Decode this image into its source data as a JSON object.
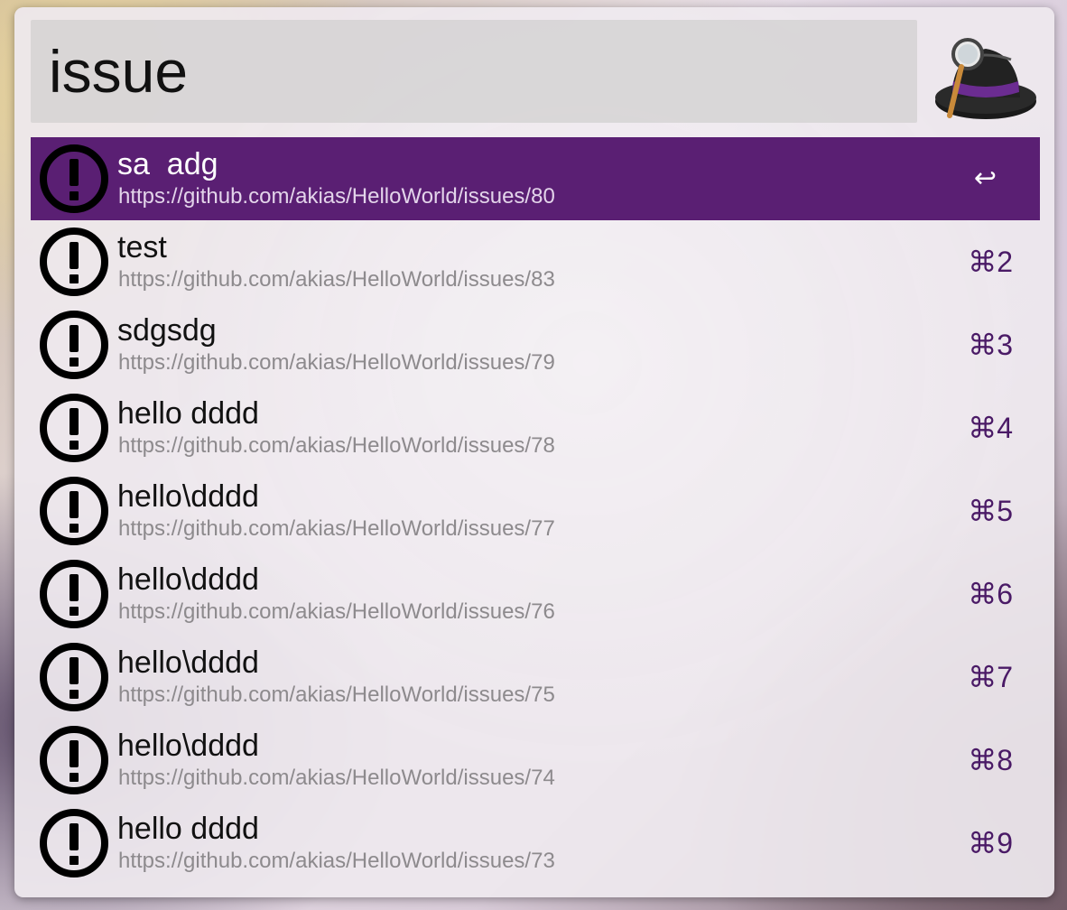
{
  "search": {
    "value": "issue"
  },
  "colors": {
    "selection": "#5a1f73",
    "shortcut": "#4a1a66",
    "subtitle": "#8d8a8d"
  },
  "results": [
    {
      "title": "sa  adg",
      "subtitle": "https://github.com/akias/HelloWorld/issues/80",
      "shortcut": "↩",
      "selected": true,
      "icon": "issue-exclamation-icon"
    },
    {
      "title": "test",
      "subtitle": "https://github.com/akias/HelloWorld/issues/83",
      "shortcut": "⌘2",
      "icon": "issue-exclamation-icon"
    },
    {
      "title": "sdgsdg",
      "subtitle": "https://github.com/akias/HelloWorld/issues/79",
      "shortcut": "⌘3",
      "icon": "issue-exclamation-icon"
    },
    {
      "title": "hello dddd",
      "subtitle": "https://github.com/akias/HelloWorld/issues/78",
      "shortcut": "⌘4",
      "icon": "issue-exclamation-icon"
    },
    {
      "title": "hello\\dddd",
      "subtitle": "https://github.com/akias/HelloWorld/issues/77",
      "shortcut": "⌘5",
      "icon": "issue-exclamation-icon"
    },
    {
      "title": "hello\\dddd",
      "subtitle": "https://github.com/akias/HelloWorld/issues/76",
      "shortcut": "⌘6",
      "icon": "issue-exclamation-icon"
    },
    {
      "title": "hello\\dddd",
      "subtitle": "https://github.com/akias/HelloWorld/issues/75",
      "shortcut": "⌘7",
      "icon": "issue-exclamation-icon"
    },
    {
      "title": "hello\\dddd",
      "subtitle": "https://github.com/akias/HelloWorld/issues/74",
      "shortcut": "⌘8",
      "icon": "issue-exclamation-icon"
    },
    {
      "title": "hello dddd",
      "subtitle": "https://github.com/akias/HelloWorld/issues/73",
      "shortcut": "⌘9",
      "icon": "issue-exclamation-icon"
    }
  ]
}
